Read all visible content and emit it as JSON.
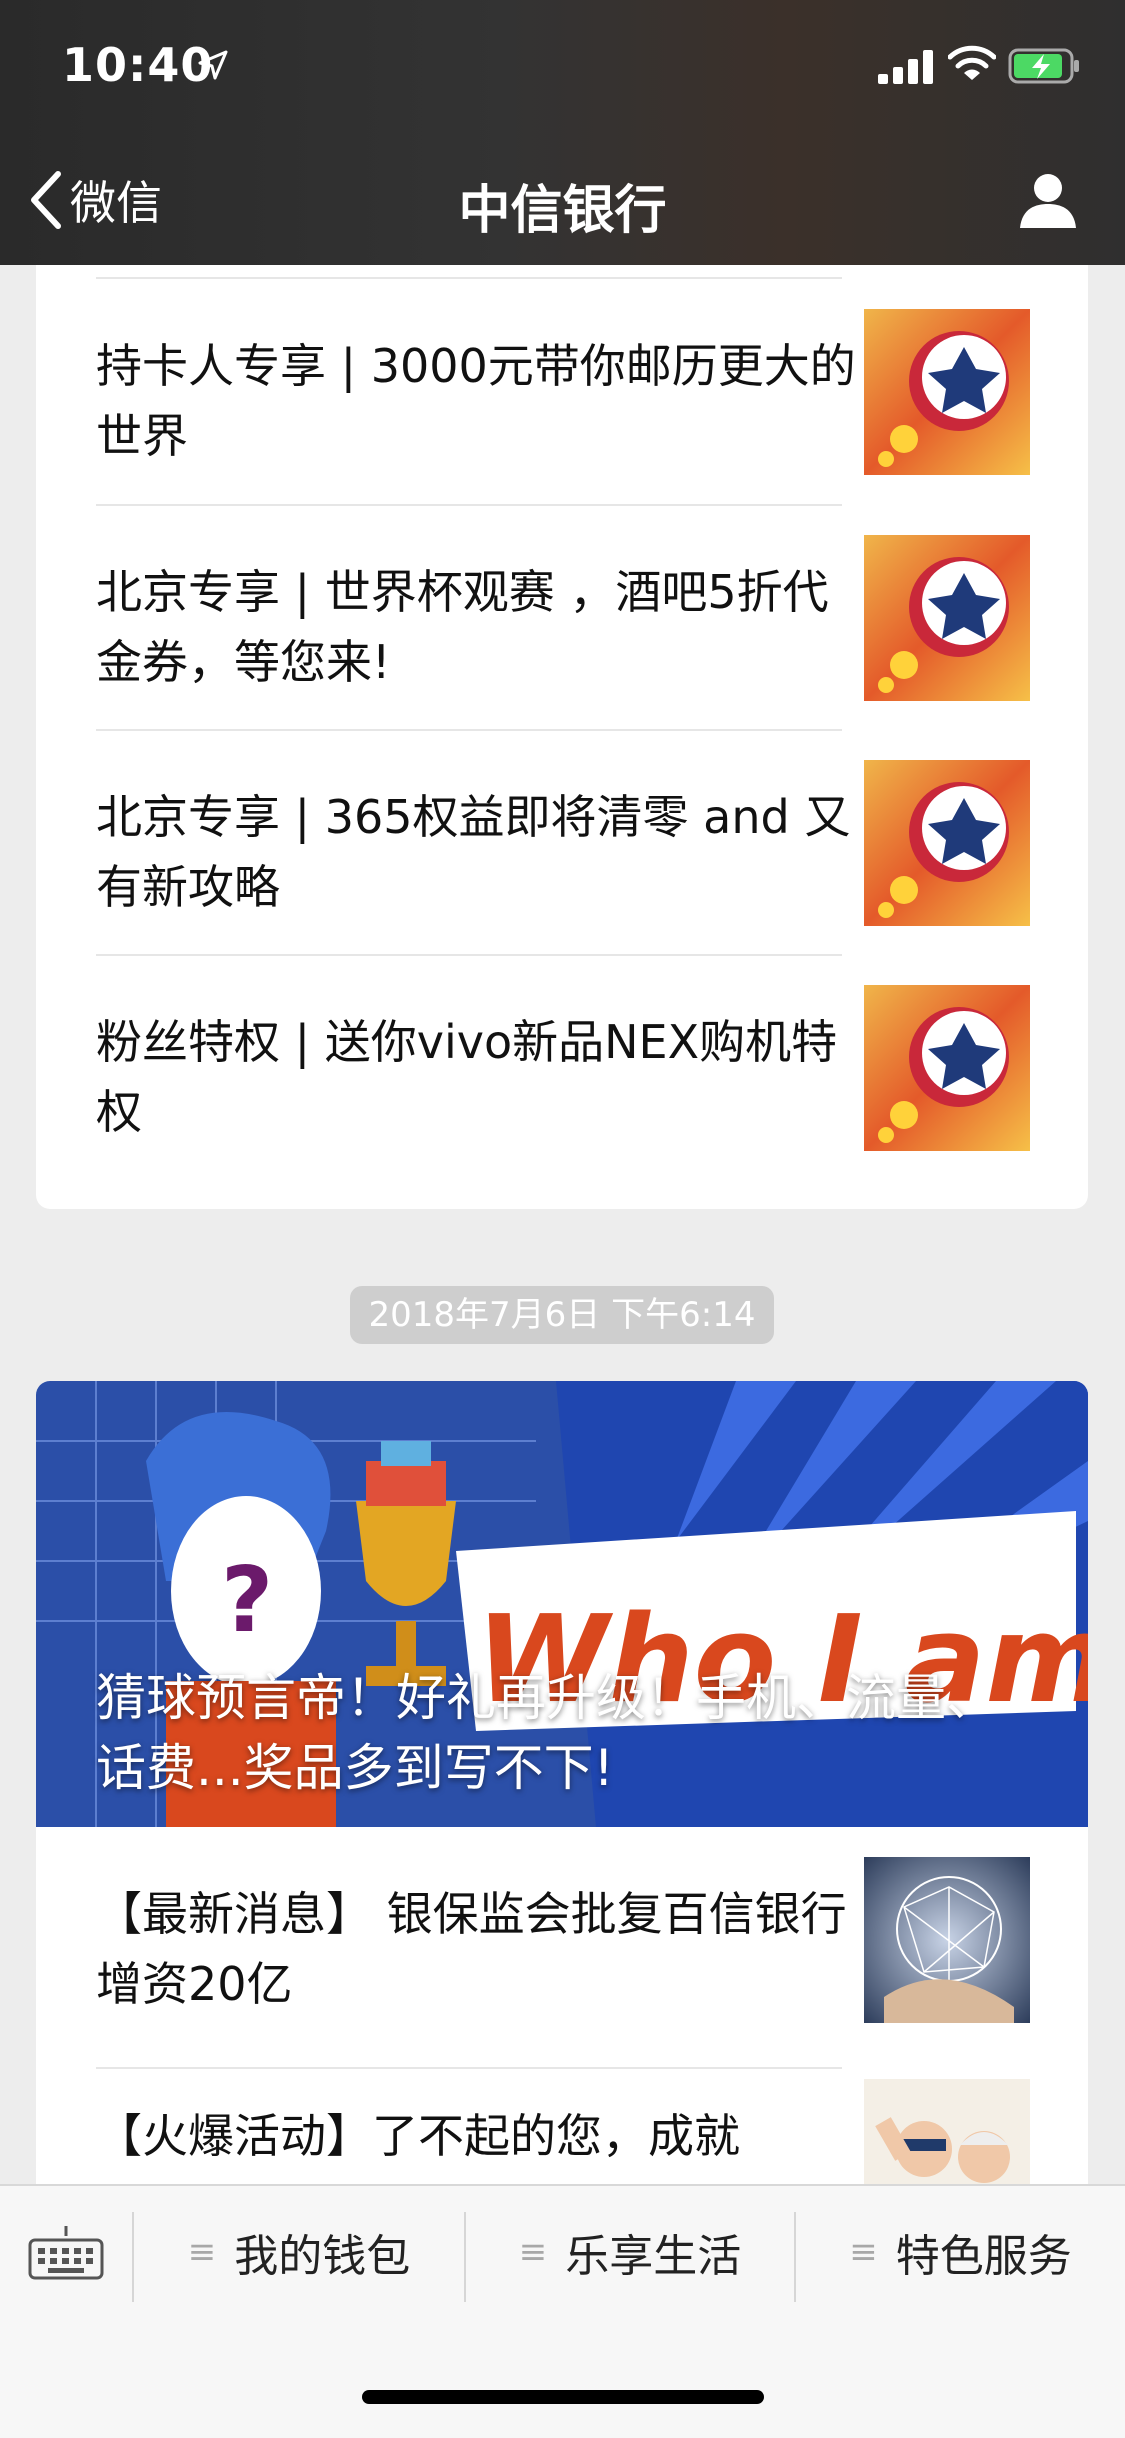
{
  "status": {
    "time": "10:40"
  },
  "nav": {
    "back_label": "微信",
    "title": "中信银行"
  },
  "articles_top": [
    {
      "title": "持卡人专享 | 3000元带你邮历更大的世界",
      "thumb_icon": "soccer-ball"
    },
    {
      "title": "北京专享 | 世界杯观赛 ，酒吧5折代金券，等您来!",
      "thumb_icon": "soccer-ball"
    },
    {
      "title": "北京专享 | 365权益即将清零 and 又有新攻略",
      "thumb_icon": "soccer-ball"
    },
    {
      "title": "粉丝特权 | 送你vivo新品NEX购机特权",
      "thumb_icon": "soccer-ball"
    }
  ],
  "timestamp": "2018年7月6日 下午6:14",
  "banner": {
    "title": "猜球预言帝！好礼再升级！手机、流量、话费...奖品多到写不下!",
    "art_text": "Who I am ?"
  },
  "articles_bottom": [
    {
      "title": "【最新消息】 银保监会批复百信银行增资20亿",
      "thumb_icon": "network-globe"
    },
    {
      "title": "【火爆活动】了不起的您，成就",
      "thumb_icon": "elderly-couple"
    }
  ],
  "menu": [
    {
      "label": "我的钱包"
    },
    {
      "label": "乐享生活"
    },
    {
      "label": "特色服务"
    }
  ],
  "colors": {
    "topbar": "#333333",
    "banner_blue": "#2b4fa8",
    "accent_orange": "#d9481e"
  }
}
